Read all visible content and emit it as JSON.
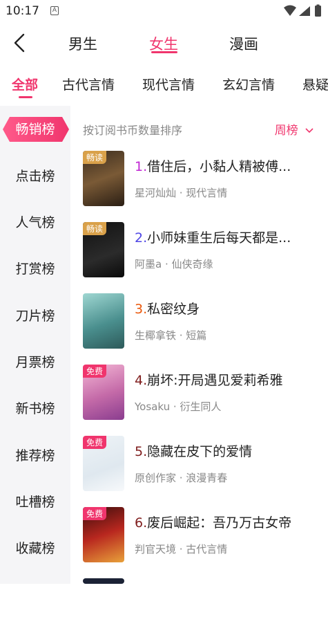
{
  "status": {
    "time": "10:17",
    "notif": "A"
  },
  "top_tabs": [
    {
      "label": "男生"
    },
    {
      "label": "女生"
    },
    {
      "label": "漫画"
    }
  ],
  "categories": [
    {
      "label": "全部"
    },
    {
      "label": "古代言情"
    },
    {
      "label": "现代言情"
    },
    {
      "label": "玄幻言情"
    },
    {
      "label": "悬疑"
    }
  ],
  "sidebar": {
    "items": [
      {
        "label": "畅销榜"
      },
      {
        "label": "点击榜"
      },
      {
        "label": "人气榜"
      },
      {
        "label": "打赏榜"
      },
      {
        "label": "刀片榜"
      },
      {
        "label": "月票榜"
      },
      {
        "label": "新书榜"
      },
      {
        "label": "推荐榜"
      },
      {
        "label": "吐槽榜"
      },
      {
        "label": "收藏榜"
      }
    ]
  },
  "main": {
    "sort_label": "按订阅书币数量排序",
    "period": "周榜",
    "books": [
      {
        "rank": "1.",
        "title": "借住后，小黏人精被傅...",
        "meta": "星河灿灿 · 现代言情",
        "badge": "畅读",
        "rank_color": "#c026d3"
      },
      {
        "rank": "2.",
        "title": "小师妹重生后每天都是...",
        "meta": "阿墨a · 仙侠奇缘",
        "badge": "畅读",
        "rank_color": "#4f46e5"
      },
      {
        "rank": "3.",
        "title": "私密纹身",
        "meta": "生椰拿铁 · 短篇",
        "badge": "",
        "rank_color": "#ea580c"
      },
      {
        "rank": "4.",
        "title": "崩坏:开局遇见爱莉希雅",
        "meta": "Yosaku · 衍生同人",
        "badge": "免费",
        "rank_color": "#7f1d1d"
      },
      {
        "rank": "5.",
        "title": "隐藏在皮下的爱情",
        "meta": "原创作家 · 浪漫青春",
        "badge": "免费",
        "rank_color": "#7f1d1d"
      },
      {
        "rank": "6.",
        "title": "废后崛起：吾乃万古女帝",
        "meta": "判官天境 · 古代言情",
        "badge": "免费",
        "rank_color": "#7f1d1d"
      }
    ]
  }
}
